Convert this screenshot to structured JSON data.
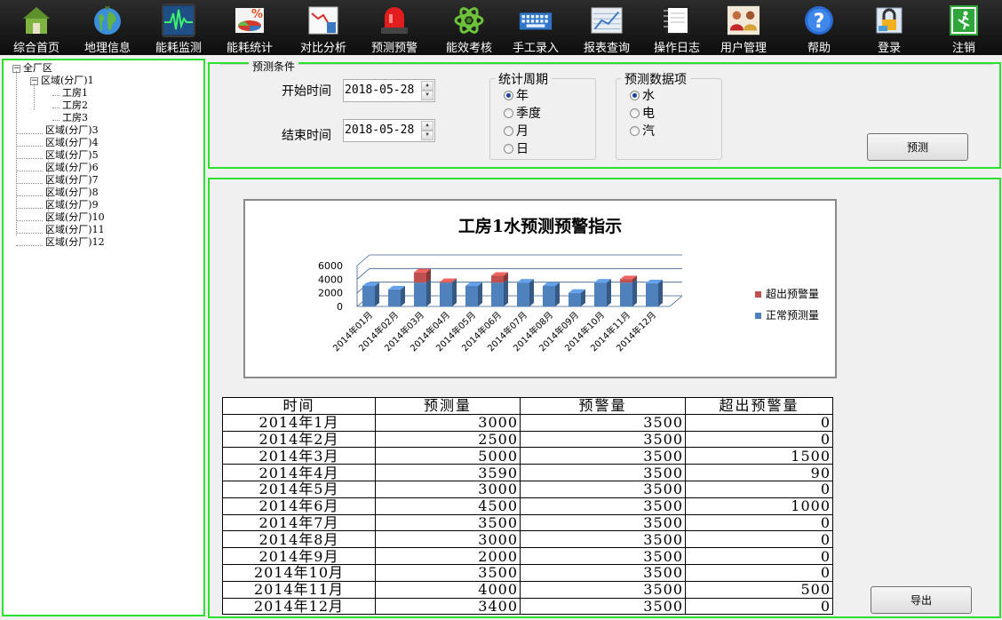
{
  "toolbar": [
    {
      "label": "综合首页",
      "icon": "home-icon"
    },
    {
      "label": "地理信息",
      "icon": "globe-icon"
    },
    {
      "label": "能耗监测",
      "icon": "pulse-monitor-icon",
      "active": true
    },
    {
      "label": "能耗统计",
      "icon": "pie-chart-icon"
    },
    {
      "label": "对比分析",
      "icon": "line-chart-icon"
    },
    {
      "label": "预测预警",
      "icon": "alarm-siren-icon"
    },
    {
      "label": "能效考核",
      "icon": "atom-icon"
    },
    {
      "label": "手工录入",
      "icon": "keyboard-icon"
    },
    {
      "label": "报表查询",
      "icon": "report-icon"
    },
    {
      "label": "操作日志",
      "icon": "notebook-icon"
    },
    {
      "label": "用户管理",
      "icon": "users-icon"
    },
    {
      "label": "帮助",
      "icon": "help-icon"
    },
    {
      "label": "登录",
      "icon": "lock-icon"
    },
    {
      "label": "注销",
      "icon": "exit-icon"
    }
  ],
  "tree": {
    "root": "全厂区",
    "region1": "区域(分厂)1",
    "rooms": [
      "工房1",
      "工房2",
      "工房3"
    ],
    "regions": [
      "区域(分厂)3",
      "区域(分厂)4",
      "区域(分厂)5",
      "区域(分厂)6",
      "区域(分厂)7",
      "区域(分厂)8",
      "区域(分厂)9",
      "区域(分厂)10",
      "区域(分厂)11",
      "区域(分厂)12"
    ],
    "expander_open": "−"
  },
  "conditions": {
    "title": "预测条件",
    "start_label": "开始时间",
    "start_value": "2018-05-28",
    "end_label": "结束时间",
    "end_value": "2018-05-28",
    "period_title": "统计周期",
    "period_options": [
      "年",
      "季度",
      "月",
      "日"
    ],
    "period_selected": 0,
    "item_title": "预测数据项",
    "item_options": [
      "水",
      "电",
      "汽"
    ],
    "item_selected": 0,
    "predict_button": "预测",
    "spin_up": "▲",
    "spin_down": "▼"
  },
  "chart_data": {
    "type": "bar",
    "title": "工房1水预测预警指示",
    "categories": [
      "2014年01月",
      "2014年02月",
      "2014年03月",
      "2014年04月",
      "2014年05月",
      "2014年06月",
      "2014年07月",
      "2014年08月",
      "2014年09月",
      "2014年10月",
      "2014年11月",
      "2014年12月"
    ],
    "series": [
      {
        "name": "正常预测量",
        "color": "#4f81bd",
        "values": [
          3000,
          2500,
          3500,
          3500,
          3000,
          3500,
          3500,
          3000,
          2000,
          3500,
          3500,
          3400
        ]
      },
      {
        "name": "超出预警量",
        "color": "#c0504d",
        "values": [
          0,
          0,
          1500,
          90,
          0,
          1000,
          0,
          0,
          0,
          0,
          500,
          0
        ]
      }
    ],
    "stacked": true,
    "yticks": [
      "6000",
      "4000",
      "2000",
      "0"
    ],
    "ylim": [
      0,
      6000
    ],
    "legend_position": "right"
  },
  "table": {
    "headers": [
      "时间",
      "预测量",
      "预警量",
      "超出预警量"
    ],
    "rows": [
      [
        "2014年1月",
        "3000",
        "3500",
        "0"
      ],
      [
        "2014年2月",
        "2500",
        "3500",
        "0"
      ],
      [
        "2014年3月",
        "5000",
        "3500",
        "1500"
      ],
      [
        "2014年4月",
        "3590",
        "3500",
        "90"
      ],
      [
        "2014年5月",
        "3000",
        "3500",
        "0"
      ],
      [
        "2014年6月",
        "4500",
        "3500",
        "1000"
      ],
      [
        "2014年7月",
        "3500",
        "3500",
        "0"
      ],
      [
        "2014年8月",
        "3000",
        "3500",
        "0"
      ],
      [
        "2014年9月",
        "2000",
        "3500",
        "0"
      ],
      [
        "2014年10月",
        "3500",
        "3500",
        "0"
      ],
      [
        "2014年11月",
        "4000",
        "3500",
        "500"
      ],
      [
        "2014年12月",
        "3400",
        "3500",
        "0"
      ]
    ]
  },
  "export_button": "导出"
}
